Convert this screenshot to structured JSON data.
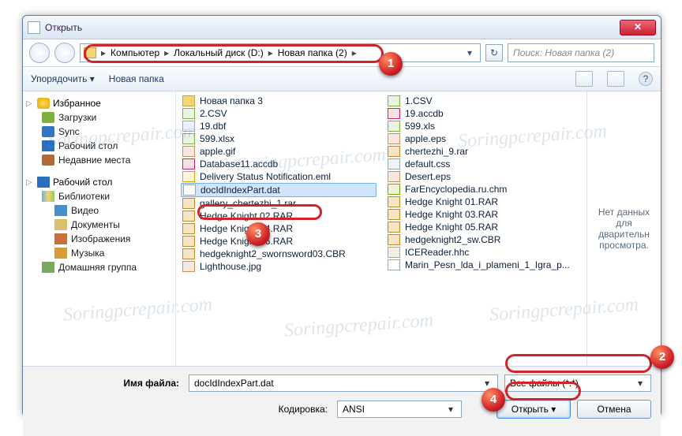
{
  "window": {
    "title": "Открыть"
  },
  "address": {
    "parts": [
      "Компьютер",
      "Локальный диск (D:)",
      "Новая папка (2)"
    ],
    "refresh_glyph": "↻",
    "drop_glyph": "▾"
  },
  "search": {
    "placeholder": "Поиск: Новая папка (2)"
  },
  "toolbar": {
    "organize": "Упорядочить",
    "newfolder": "Новая папка",
    "drop_glyph": "▾",
    "help_glyph": "?"
  },
  "sidebar": {
    "fav": {
      "label": "Избранное",
      "items": [
        "Загрузки",
        "Sync",
        "Рабочий стол",
        "Недавние места"
      ]
    },
    "desk": {
      "label": "Рабочий стол"
    },
    "libs": {
      "label": "Библиотеки",
      "items": [
        "Видео",
        "Документы",
        "Изображения",
        "Музыка"
      ]
    },
    "home": {
      "label": "Домашняя группа"
    }
  },
  "files_left": [
    {
      "name": "Новая папка 3",
      "ico": "f-folder"
    },
    {
      "name": "2.CSV",
      "ico": "f-csv"
    },
    {
      "name": "19.dbf",
      "ico": "f-dbf"
    },
    {
      "name": "599.xlsx",
      "ico": "f-xls"
    },
    {
      "name": "apple.gif",
      "ico": "f-gif"
    },
    {
      "name": "Database11.accdb",
      "ico": "f-accdb"
    },
    {
      "name": "Delivery Status Notification.eml",
      "ico": "f-eml"
    },
    {
      "name": "docIdIndexPart.dat",
      "ico": "f-dat",
      "sel": true
    },
    {
      "name": "gallery_chertezhi_1.rar",
      "ico": "f-rar"
    },
    {
      "name": "Hedge Knight 02.RAR",
      "ico": "f-rar"
    },
    {
      "name": "Hedge Knight 04.RAR",
      "ico": "f-rar"
    },
    {
      "name": "Hedge Knight 06.RAR",
      "ico": "f-rar"
    },
    {
      "name": "hedgeknight2_swornsword03.CBR",
      "ico": "f-cbr"
    },
    {
      "name": "Lighthouse.jpg",
      "ico": "f-jpg"
    }
  ],
  "files_right": [
    {
      "name": "1.CSV",
      "ico": "f-csv"
    },
    {
      "name": "19.accdb",
      "ico": "f-accdb"
    },
    {
      "name": "599.xls",
      "ico": "f-xls"
    },
    {
      "name": "apple.eps",
      "ico": "f-eps"
    },
    {
      "name": "chertezhi_9.rar",
      "ico": "f-rar"
    },
    {
      "name": "default.css",
      "ico": "f-css"
    },
    {
      "name": "Desert.eps",
      "ico": "f-eps"
    },
    {
      "name": "FarEncyclopedia.ru.chm",
      "ico": "f-chm"
    },
    {
      "name": "Hedge Knight 01.RAR",
      "ico": "f-rar"
    },
    {
      "name": "Hedge Knight 03.RAR",
      "ico": "f-rar"
    },
    {
      "name": "Hedge Knight 05.RAR",
      "ico": "f-rar"
    },
    {
      "name": "hedgeknight2_sw.CBR",
      "ico": "f-cbr"
    },
    {
      "name": "ICEReader.hhc",
      "ico": "f-hhc"
    },
    {
      "name": "Marin_Pesn_lda_i_plameni_1_Igra_p...",
      "ico": "f-dat"
    }
  ],
  "preview": {
    "text": "Нет данных для дварительн просмотра."
  },
  "bottom": {
    "filename_label": "Имя файла:",
    "filename_value": "docIdIndexPart.dat",
    "encoding_label": "Кодировка:",
    "encoding_value": "ANSI",
    "filetype_value": "Все файлы (*.*)",
    "open": "Открыть",
    "cancel": "Отмена"
  },
  "callouts": {
    "n1": "1",
    "n2": "2",
    "n3": "3",
    "n4": "4"
  },
  "watermark": "Soringpcrepair.com"
}
